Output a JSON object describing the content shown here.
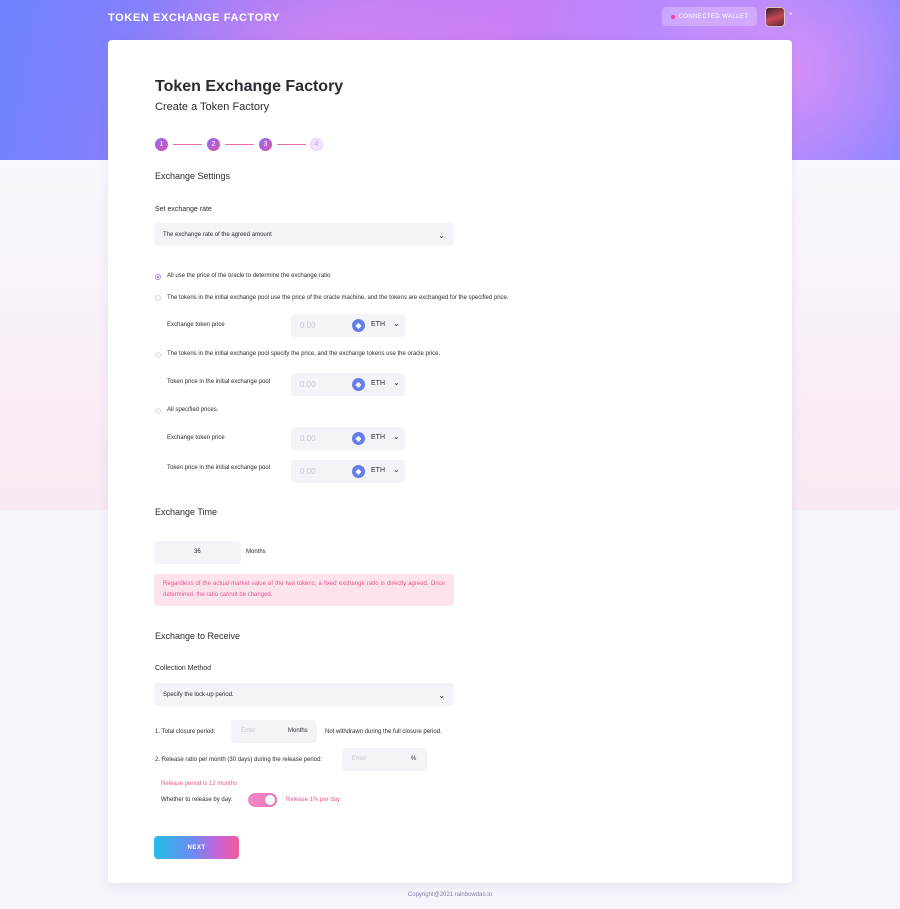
{
  "header": {
    "brand": "TOKEN EXCHANGE FACTORY",
    "wallet_label": "CONNECTED WALLET",
    "avatar_caret": "˅"
  },
  "page": {
    "title": "Token Exchange Factory",
    "subtitle": "Create a Token Factory"
  },
  "steps": [
    "1",
    "2",
    "3",
    "4"
  ],
  "exchange_settings": {
    "section_title": "Exchange Settings",
    "rate_label": "Set exchange rate",
    "rate_select": "The exchange rate of the agreed amount",
    "options": [
      "All use the price of the oracle to determine the exchange ratio",
      "The tokens in the initial exchange pool use the price of the oracle machine, and the tokens are exchanged for the specified price.",
      "The tokens in the initial exchange pool specify the price, and the exchange tokens use the oracle price.",
      "All specified prices."
    ],
    "exchange_token_price_label": "Exchange token price",
    "initial_pool_price_label": "Token price in the initial exchange pool",
    "price_value": "0.00",
    "price_unit": "ETH"
  },
  "exchange_time": {
    "section_title": "Exchange Time",
    "value": "36",
    "unit": "Months",
    "notice": "Regardless of the actual market value of the two tokens, a fixed exchange ratio is directly agreed. Once determined, the ratio cannot be changed."
  },
  "exchange_receive": {
    "section_title": "Exchange to Receive",
    "method_label": "Collection Method",
    "method_select": "Specify the lock-up period.",
    "closure_label": "1. Total closure period:",
    "closure_placeholder": "Enter",
    "closure_unit": "Months",
    "closure_note": "Not withdrawn during the full closure period.",
    "release_label": "2. Release ratio per month (30 days) during the release period:",
    "release_placeholder": "Enter",
    "release_unit": "%",
    "release_period_text": "Release period is 12 months",
    "by_day_label": "Whether to release by day:",
    "by_day_note": "Release 1% per day",
    "by_day_enabled": true
  },
  "actions": {
    "next": "NEXT"
  },
  "footer": {
    "copyright": "Copyright@2021 rainbowdao.io"
  },
  "colors": {
    "accent_pink": "#e2568f",
    "eth_blue": "#627eea"
  }
}
